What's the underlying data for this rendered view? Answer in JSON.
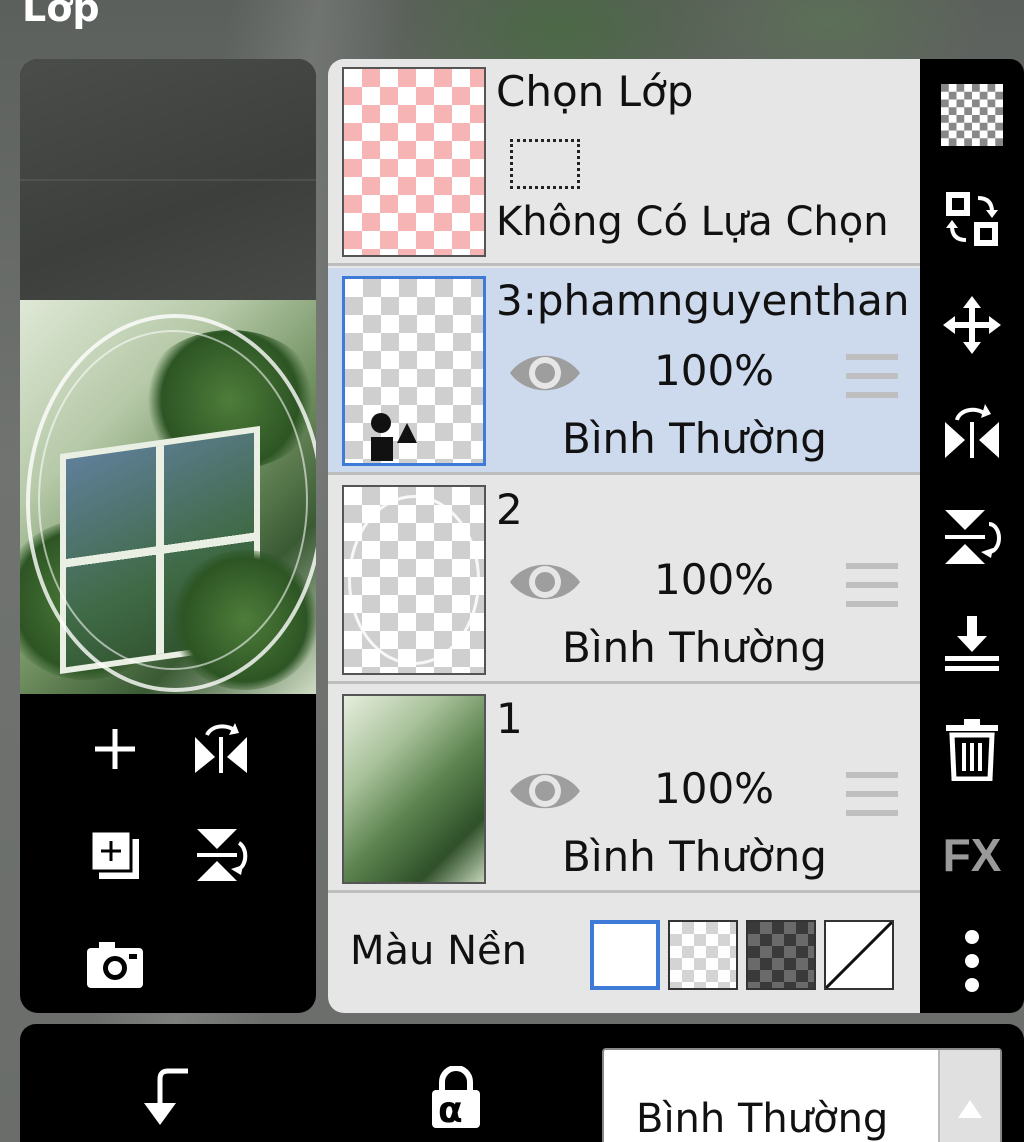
{
  "app": {
    "title": "Lớp"
  },
  "selection_layer": {
    "name": "Chọn Lớp",
    "status": "Không Có Lựa Chọn"
  },
  "layers": [
    {
      "name": "3:phamnguyenthan",
      "opacity": "100%",
      "blend": "Bình Thường",
      "selected": true
    },
    {
      "name": "2",
      "opacity": "100%",
      "blend": "Bình Thường",
      "selected": false
    },
    {
      "name": "1",
      "opacity": "100%",
      "blend": "Bình Thường",
      "selected": false
    }
  ],
  "background_color": {
    "label": "Màu Nền",
    "options": [
      "white",
      "transparent",
      "dark-checker",
      "none"
    ],
    "selected": "white"
  },
  "right_tools": [
    "checkerboard-icon",
    "swap-layers-icon",
    "move-icon",
    "flip-horizontal-icon",
    "flip-vertical-icon",
    "merge-down-icon",
    "trash-icon",
    "fx-icon",
    "more-vertical-icon"
  ],
  "right_tools_labels": {
    "fx": "FX"
  },
  "left_tools": [
    "add-layer-icon",
    "flip-horizontal-icon",
    "duplicate-layer-icon",
    "flip-vertical-icon",
    "camera-icon"
  ],
  "bottom_bar": {
    "blend_mode": "Bình Thường",
    "alpha_symbol": "α"
  },
  "colors": {
    "accent": "#3d7bd6",
    "selected_row": "#cdd9ec",
    "panel": "#e6e6e6"
  }
}
